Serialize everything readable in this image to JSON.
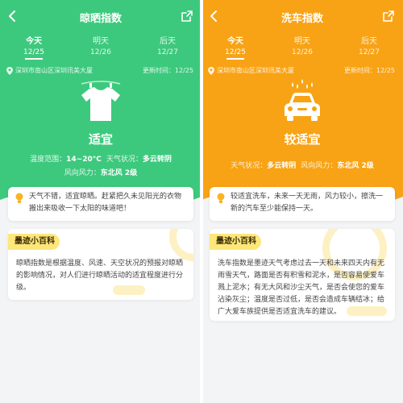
{
  "left": {
    "title": "晾晒指数",
    "tabs": [
      {
        "day": "今天",
        "date": "12/25"
      },
      {
        "day": "明天",
        "date": "12/26"
      },
      {
        "day": "后天",
        "date": "12/27"
      }
    ],
    "location": "深圳市南山区深圳讯美大厦",
    "updated": "更新时间：12/25",
    "level": "适宜",
    "details_line1": {
      "label1": "温度范围：",
      "value1": "14~20°C",
      "label2": "天气状况：",
      "value2": "多云转阴"
    },
    "details_line2": {
      "label1": "风向风力：",
      "value1": "东北风 2级"
    },
    "tip": "天气不错，适宜晾晒。赶紧把久未见阳光的衣物搬出来吸收一下太阳的味道吧！",
    "encyclopedia": {
      "badge": "墨迹小百科",
      "text": "晾晒指数是根据温度、风速、天空状况的预报对晾晒的影响情况，对人们进行晾晒活动的适宜程度进行分级。"
    },
    "colors": {
      "accent": "#3dc97d"
    }
  },
  "right": {
    "title": "洗车指数",
    "tabs": [
      {
        "day": "今天",
        "date": "12/25"
      },
      {
        "day": "明天",
        "date": "12/26"
      },
      {
        "day": "后天",
        "date": "12/27"
      }
    ],
    "location": "深圳市南山区深圳讯美大厦",
    "updated": "更新时间：12/25",
    "level": "较适宜",
    "details_line1": {
      "label1": "天气状况：",
      "value1": "多云转阴",
      "label2": "风向风力：",
      "value2": "东北风 2级"
    },
    "tip": "较适宜洗车，未来一天无雨，风力较小，擦洗一新的汽车至少能保持一天。",
    "encyclopedia": {
      "badge": "墨迹小百科",
      "text": "洗车指数是墨迹天气考虑过去一天和未来四天内有无雨雪天气，路面是否有积雪和泥水，是否容易使爱车溅上泥水；有无大风和沙尘天气，是否会使您的爱车沾染灰尘；温度是否过低，是否会造成车辆结冰；给广大爱车族提供是否适宜洗车的建议。"
    },
    "colors": {
      "accent": "#f8a315"
    }
  },
  "icons": [
    "back-icon",
    "share-icon",
    "location-pin-icon",
    "shirt-icon",
    "car-wash-icon",
    "lightbulb-icon"
  ]
}
